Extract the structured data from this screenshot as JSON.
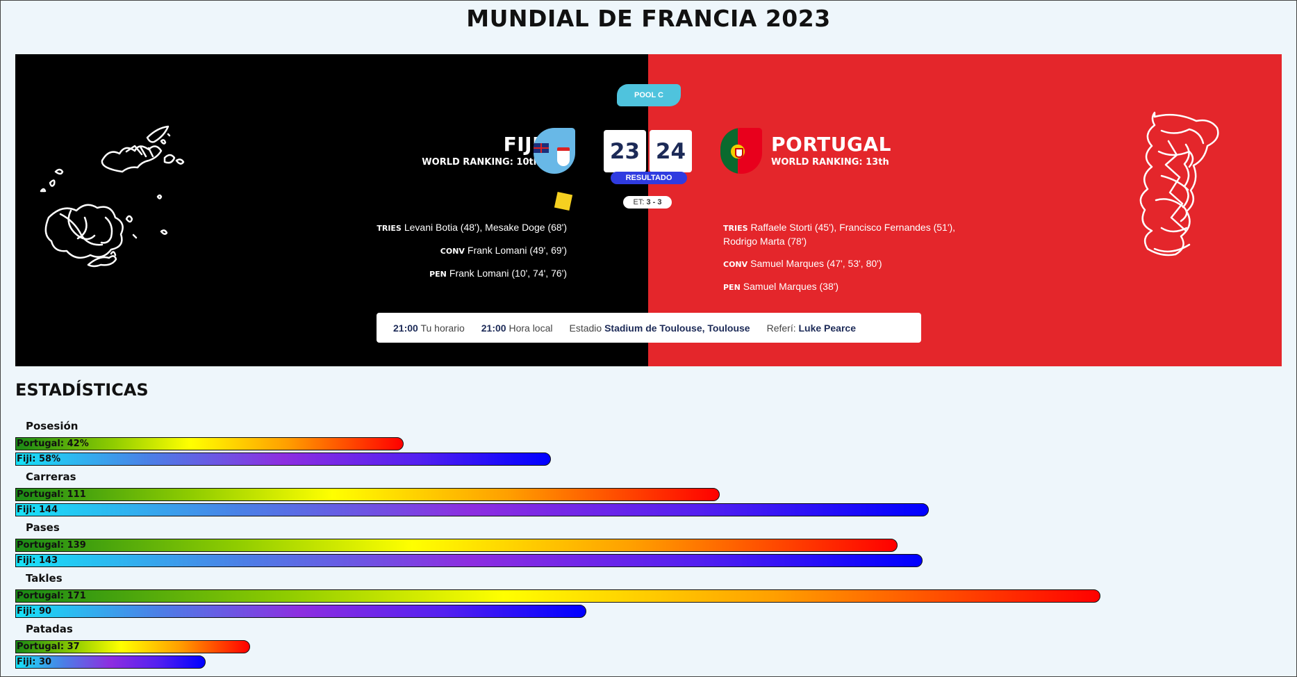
{
  "title": "MUNDIAL DE FRANCIA 2023",
  "match": {
    "pool": "POOL C",
    "home": {
      "name": "FIJI",
      "ranking": "WORLD RANKING: 10th",
      "score": "23",
      "tries": "Levani Botia (48'), Mesake Doge (68')",
      "conv": "Frank Lomani (49', 69')",
      "pen": "Frank Lomani (10', 74', 76')"
    },
    "away": {
      "name": "PORTUGAL",
      "ranking": "WORLD RANKING: 13th",
      "score": "24",
      "tries_line1": "Raffaele Storti (45'), Francisco Fernandes (51'),",
      "tries_line2": "Rodrigo Marta (78')",
      "conv": "Samuel Marques (47', 53', 80')",
      "pen": "Samuel Marques (38')"
    },
    "status": "RESULTADO",
    "et_label": "ET:",
    "et_score": "3 - 3",
    "labels": {
      "tries": "TRIES",
      "conv": "CONV",
      "pen": "PEN"
    },
    "info": {
      "your_time": "21:00",
      "your_time_label": "Tu horario",
      "local_time": "21:00",
      "local_time_label": "Hora local",
      "stadium_label": "Estadio",
      "stadium": "Stadium de Toulouse, Toulouse",
      "referee_label": "Referí:",
      "referee": "Luke Pearce"
    }
  },
  "stats_title": "ESTADÍSTICAS",
  "colors": {
    "left_panel": "#000000",
    "right_panel": "#e4262b",
    "pool_badge": "#4fc3dd",
    "status_pill": "#2f3be0"
  },
  "chart_data": {
    "type": "bar",
    "categories": [
      "Posesión",
      "Carreras",
      "Pases",
      "Takles",
      "Patadas"
    ],
    "series": [
      {
        "name": "Portugal",
        "values": [
          42,
          111,
          139,
          171,
          37
        ],
        "labels": [
          "Portugal: 42%",
          "Portugal: 111",
          "Portugal: 139",
          "Portugal: 171",
          "Portugal: 37"
        ]
      },
      {
        "name": "Fiji",
        "values": [
          58,
          144,
          143,
          90,
          30
        ],
        "labels": [
          "Fiji: 58%",
          "Fiji: 144",
          "Fiji: 143",
          "Fiji: 90",
          "Fiji: 30"
        ]
      }
    ]
  }
}
